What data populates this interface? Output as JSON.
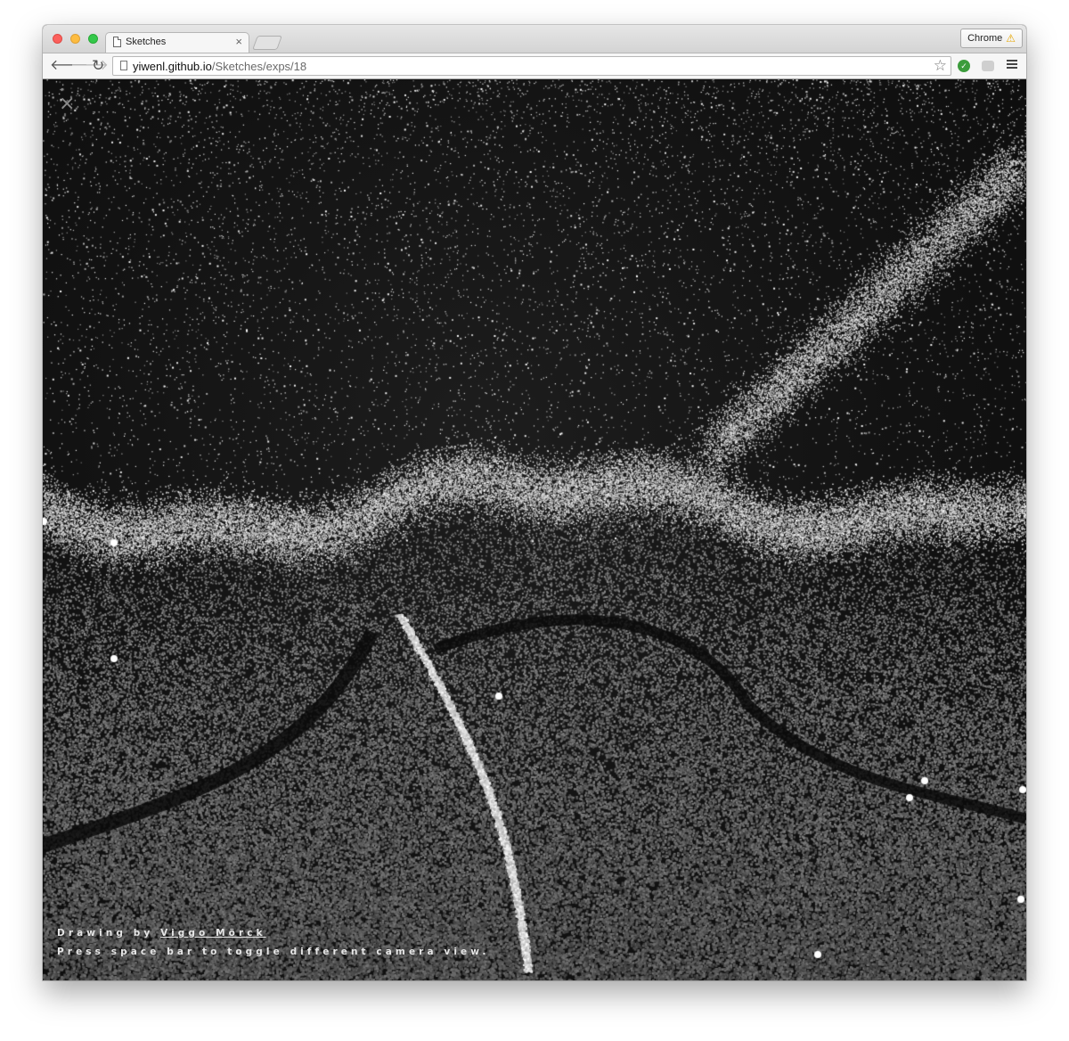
{
  "browser": {
    "tab_title": "Sketches",
    "tab_close": "×",
    "profile_label": "Chrome",
    "url_host": "yiwenl.github.io",
    "url_path": "/Sketches/exps/18",
    "icons": {
      "page": "page-icon",
      "back": "back-arrow-icon",
      "forward": "forward-arrow-icon",
      "reload": "reload-icon",
      "bookmark": "star-icon",
      "extension_1": "extension-check-icon",
      "extension_2": "extension-icon",
      "menu": "hamburger-menu-icon",
      "warning": "warning-icon"
    }
  },
  "page": {
    "close_symbol": "×",
    "caption": {
      "drawing_by_prefix": "Drawing by",
      "artist": "Viggo Mörck",
      "instructions": "Press space bar to toggle different camera view."
    }
  },
  "colors": {
    "background": "#0e0e0e",
    "particles": "#ffffff",
    "traffic_red": "#fc605c",
    "traffic_yellow": "#fdbc40",
    "traffic_green": "#34c84a"
  }
}
